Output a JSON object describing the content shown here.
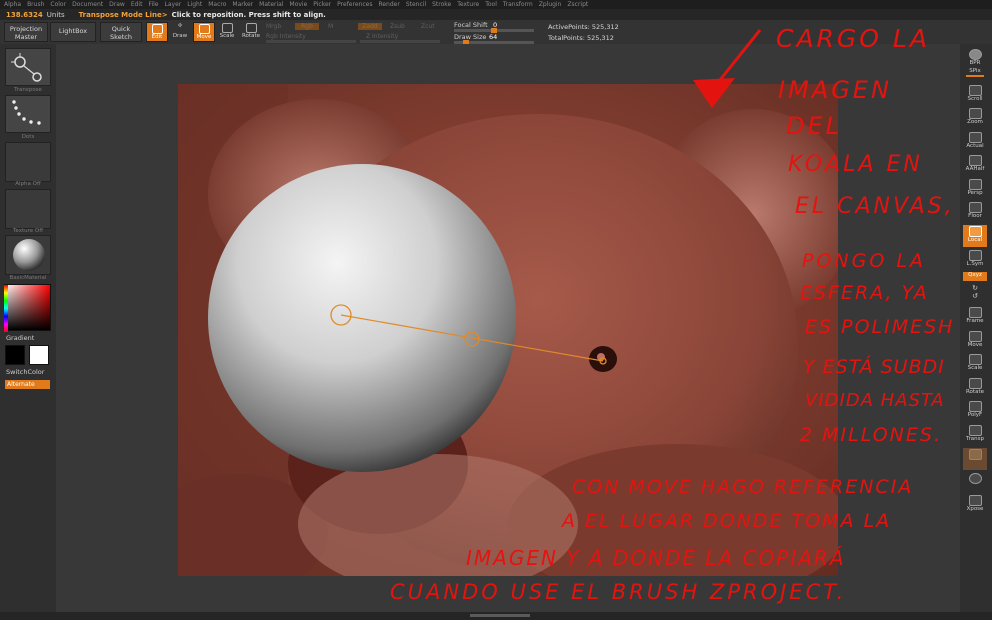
{
  "menu": [
    "Alpha",
    "Brush",
    "Color",
    "Document",
    "Draw",
    "Edit",
    "File",
    "Layer",
    "Light",
    "Macro",
    "Marker",
    "Material",
    "Movie",
    "Picker",
    "Preferences",
    "Render",
    "Stencil",
    "Stroke",
    "Texture",
    "Tool",
    "Transform",
    "Zplugin",
    "Zscript"
  ],
  "status": {
    "coords": "138.6324",
    "units": "Units",
    "mode": "Transpose Mode Line>",
    "hint": "Click to reposition. Press shift to align."
  },
  "toolbar": {
    "projection_master": "Projection Master",
    "lightbox": "LightBox",
    "quick_sketch": "Quick Sketch",
    "edit": "Edit",
    "draw": "Draw",
    "move": "Move",
    "scale": "Scale",
    "rotate": "Rotate",
    "mrgb": "Mrgb",
    "rgb": "Rgb",
    "m": "M",
    "zadd": "Zadd",
    "zsub": "Zsub",
    "zcut": "Zcut",
    "rgb_intensity": "Rgb Intensity",
    "z_intensity": "Z Intensity",
    "focal_shift_label": "Focal Shift",
    "focal_shift_value": "0",
    "draw_size_label": "Draw Size",
    "draw_size_value": "64",
    "active_points": "ActivePoints: 525,312",
    "total_points": "TotalPoints: 525,312",
    "focal_shift_fraction": 0.5,
    "draw_size_fraction": 0.12
  },
  "left_panel": {
    "transpose_caption": "Transpose",
    "dots_caption": "Dots",
    "alpha_caption": "Alpha Off",
    "texture_caption": "Texture Off",
    "material_caption": "BasicMaterial",
    "gradient": "Gradient",
    "switch_color": "SwitchColor",
    "alternate": "Alternate"
  },
  "right_panel": [
    "BPR",
    "SPix",
    "Scroll",
    "Zoom",
    "Actual",
    "AAHalf",
    "Persp",
    "Floor",
    "Local",
    "L.Sym",
    "Qxyz",
    "Frame",
    "Move",
    "Scale",
    "Rotate",
    "PolyF",
    "Transp",
    "Ghost",
    "Xpose"
  ],
  "annotations": [
    "CARGO LA",
    "IMAGEN",
    "DEL",
    "KOALA EN",
    "EL CANVAS,",
    "PONGO LA",
    "ESFERA, YA",
    "ES POLIMESH",
    "Y ESTÁ SUBDI",
    "VIDIDA HASTA",
    "2 MILLONES.",
    "CON MOVE HAGO REFERENCIA",
    "A EL LUGAR DONDE TOMA LA",
    "IMAGEN Y A DONDE LA COPIARÁ",
    "CUANDO USE EL BRUSH ZPROJECT."
  ],
  "colors": {
    "accent": "#e07a1a",
    "annotation": "#e3140f",
    "canvas_tint": "#8a3a2e"
  }
}
